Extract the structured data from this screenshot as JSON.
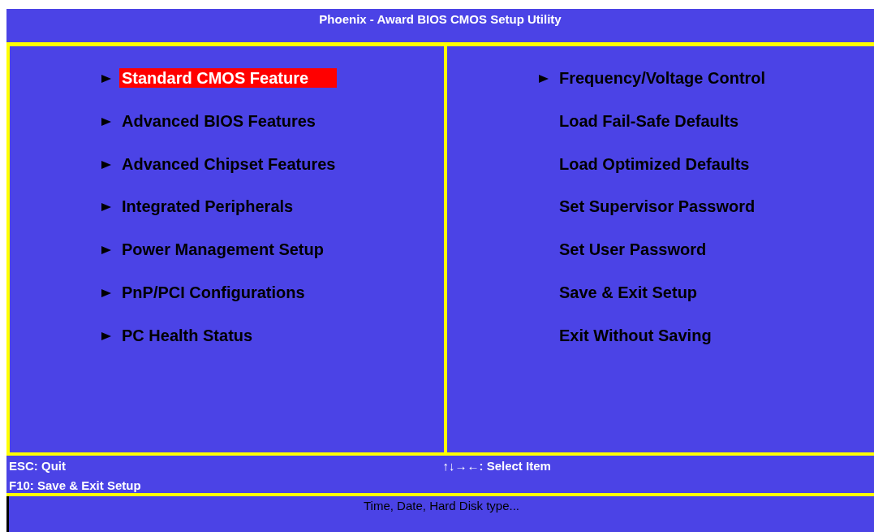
{
  "window": {
    "title": "Phoenix - Award BIOS CMOS Setup Utility"
  },
  "menu_left": [
    {
      "label": "Standard CMOS Feature",
      "submenu": true,
      "selected": true
    },
    {
      "label": "Advanced BIOS Features",
      "submenu": true,
      "selected": false
    },
    {
      "label": "Advanced Chipset Features",
      "submenu": true,
      "selected": false
    },
    {
      "label": "Integrated Peripherals",
      "submenu": true,
      "selected": false
    },
    {
      "label": "Power Management Setup",
      "submenu": true,
      "selected": false
    },
    {
      "label": "PnP/PCI Configurations",
      "submenu": true,
      "selected": false
    },
    {
      "label": "PC Health Status",
      "submenu": true,
      "selected": false
    }
  ],
  "menu_right": [
    {
      "label": "Frequency/Voltage Control",
      "submenu": true,
      "selected": false
    },
    {
      "label": "Load Fail-Safe Defaults",
      "submenu": false,
      "selected": false
    },
    {
      "label": "Load Optimized Defaults",
      "submenu": false,
      "selected": false
    },
    {
      "label": "Set Supervisor Password",
      "submenu": false,
      "selected": false
    },
    {
      "label": "Set User Password",
      "submenu": false,
      "selected": false
    },
    {
      "label": "Save & Exit Setup",
      "submenu": false,
      "selected": false
    },
    {
      "label": "Exit Without Saving",
      "submenu": false,
      "selected": false
    }
  ],
  "help": {
    "left": [
      "ESC: Quit",
      "F10: Save & Exit Setup"
    ],
    "right": [
      "↑↓→←: Select Item"
    ]
  },
  "status_bar": "Time, Date, Hard Disk type..."
}
